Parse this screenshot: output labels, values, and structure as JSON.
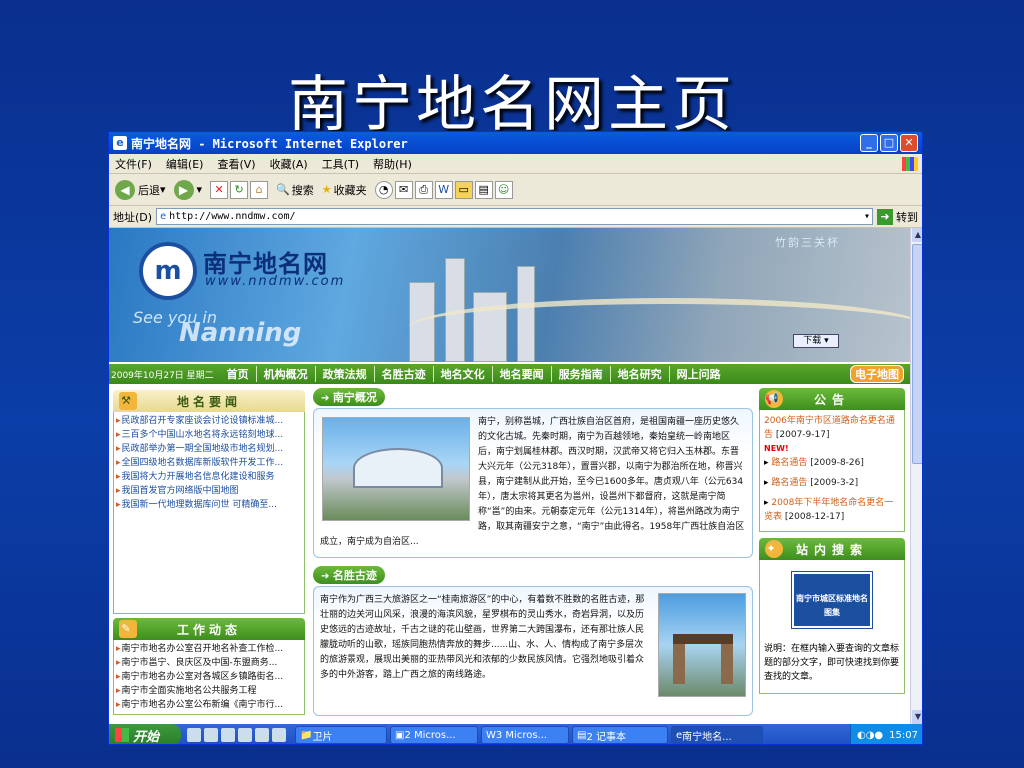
{
  "slide_title": "南宁地名网主页",
  "window": {
    "title": "南宁地名网 - Microsoft Internet Explorer",
    "min": "_",
    "max": "□",
    "close": "✕"
  },
  "menu": [
    "文件(F)",
    "编辑(E)",
    "查看(V)",
    "收藏(A)",
    "工具(T)",
    "帮助(H)"
  ],
  "toolbar": {
    "back": "后退",
    "search": "搜索",
    "favorites": "收藏夹"
  },
  "address": {
    "label": "地址(D)",
    "value": "http://www.nndmw.com/",
    "go": "转到"
  },
  "banner": {
    "site_name": "南宁地名网",
    "site_url": "www.nndmw.com",
    "see_you": "See you in",
    "nanning": "Nanning",
    "download": "下载",
    "slogan": "竹韵三关杯"
  },
  "nav": {
    "date": "2009年10月27日 星期二",
    "items": [
      "首页",
      "机构概况",
      "政策法规",
      "名胜古迹",
      "地名文化",
      "地名要闻",
      "服务指南",
      "地名研究",
      "网上问路"
    ],
    "map_button": "电子地图"
  },
  "left": {
    "news_title": "地名要闻",
    "news": [
      "民政部召开专家座谈会讨论设镇标准城...",
      "三百多个中国山水地名将永远铭刻地球...",
      "民政部举办第一期全国地级市地名规划...",
      "全国四级地名数据库新版软件开发工作...",
      "我国将大力开展地名信息化建设和服务",
      "我国首发官方网络版中国地图",
      "我国新一代地理数据库问世 可精确至..."
    ],
    "work_title": "工作动态",
    "work": [
      "南宁市地名办公室召开地名补查工作检...",
      "南宁市邕宁、良庆区及中国-东盟商务...",
      "南宁市地名办公室对各城区乡镇路街名...",
      "南宁市全面实施地名公共服务工程",
      "南宁市地名办公室公布新编《南宁市行..."
    ]
  },
  "mid": {
    "intro_title": "南宁概况",
    "intro_text": "南宁，别称邕城，广西壮族自治区首府，是祖国南疆一座历史悠久的文化古城。先秦时期，南宁为百越领地，秦始皇统一岭南地区后，南宁划属桂林郡。西汉时期，汉武帝又将它归入玉林郡。东晋大兴元年（公元318年），置晋兴郡，以南宁为郡治所在地，称晋兴县，南宁建制从此开始，至今已1600多年。唐贞观八年（公元634年），唐太宗将其更名为邕州，设邕州下都督府，这就是南宁简称“邕”的由来。元朝泰定元年（公元1314年），将邕州路改为南宁路，取其南疆安宁之意，“南宁”由此得名。1958年广西壮族自治区成立，南宁成为自治区...",
    "scenic_title": "名胜古迹",
    "scenic_text": "南宁作为广西三大旅游区之一“桂南旅游区”的中心，有着数不胜数的名胜古迹，那壮丽的边关河山风采，浪漫的海滨风貌，星罗棋布的灵山秀水，奇岩异洞，以及历史悠远的古迹故址，千古之谜的花山壁画，世界第二大跨国瀑布，还有那壮族人民朦胧动听的山歌，瑶族同胞热情奔放的舞步......山、水、人、情构成了南宁多层次的旅游景观，展现出美丽的亚热带风光和浓郁的少数民族风情。它强烈地吸引着众多的中外游客，踏上广西之旅的南线路途。"
  },
  "right": {
    "notice_title": "公告",
    "notices": [
      {
        "title": "2006年南宁市区道路命名更名通告",
        "date": "[2007-9-17]",
        "new": false
      },
      {
        "title": "路名通告",
        "date": "[2009-8-26]",
        "new": true
      },
      {
        "title": "路名通告",
        "date": "[2009-3-2]",
        "new": false
      },
      {
        "title": "2008年下半年地名命名更名一览表",
        "date": "[2008-12-17]",
        "new": false
      }
    ],
    "new_label": "NEW!",
    "search_title": "站内搜索",
    "search_img_text": "南宁市城区标准地名图集",
    "search_note": "说明：在框内输入要查询的文章标题的部分文字，即可快速找到你要查找的文章。"
  },
  "taskbar": {
    "start": "开始",
    "tasks": [
      "卫片",
      "2 Micros...",
      "3 Micros...",
      "2 记事本",
      "南宁地名..."
    ],
    "clock": "15:07"
  }
}
